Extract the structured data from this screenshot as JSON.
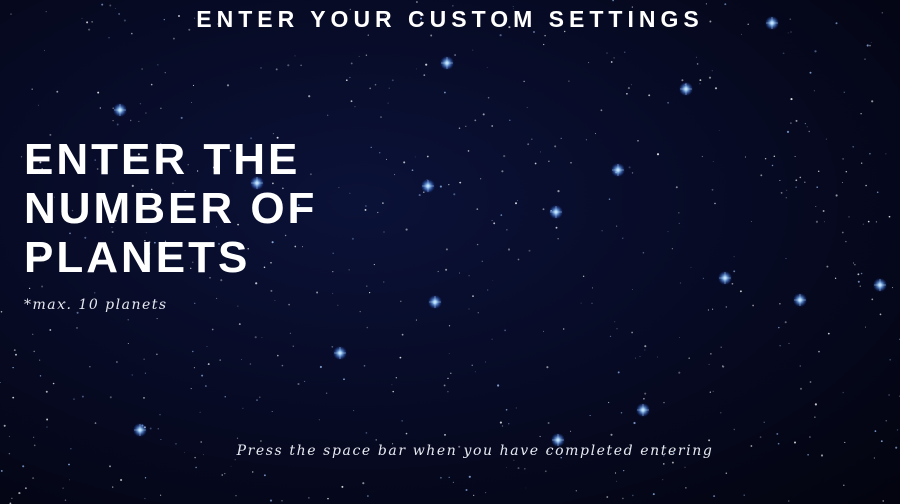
{
  "screen": {
    "title": "ENTER YOUR CUSTOM SETTINGS",
    "prompt_lines": [
      "ENTER THE",
      "NUMBER OF",
      "PLANETS"
    ],
    "max_note": "*max. 10 planets",
    "footer_hint": "Press the space bar when you have completed entering",
    "planet_count_value": ""
  },
  "colors": {
    "background": "#04061a",
    "text": "#ffffff",
    "star_glow": "#4aa8ff"
  }
}
